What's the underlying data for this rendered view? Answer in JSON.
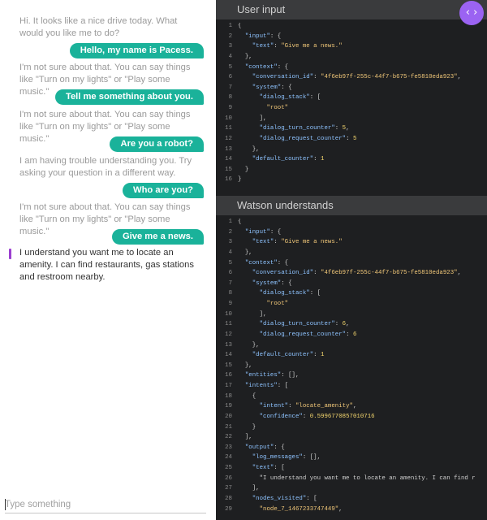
{
  "chat": {
    "messages": [
      {
        "from": "bot",
        "text": "Hi. It looks like a nice drive today. What would you like me to do?"
      },
      {
        "from": "user",
        "text": "Hello, my name is Pacess."
      },
      {
        "from": "bot",
        "text": "I'm not sure about that. You can say things like \"Turn on my lights\" or \"Play some music.\""
      },
      {
        "from": "user",
        "text": "Tell me something about you."
      },
      {
        "from": "bot",
        "text": "I'm not sure about that. You can say things like \"Turn on my lights\" or \"Play some music.\""
      },
      {
        "from": "user",
        "text": "Are you a robot?"
      },
      {
        "from": "bot",
        "text": "I am having trouble understanding you. Try asking your question in a different way."
      },
      {
        "from": "user",
        "text": "Who are you?"
      },
      {
        "from": "bot",
        "text": "I'm not sure about that. You can say things like \"Turn on my lights\" or \"Play some music.\""
      },
      {
        "from": "user",
        "text": "Give me a news."
      },
      {
        "from": "bot",
        "text": "I understand you want me to locate an amenity. I can find restaurants, gas stations and restroom nearby.",
        "latest": true
      }
    ],
    "input_placeholder": "Type something"
  },
  "panels": {
    "user_input": {
      "title": "User input",
      "lines": [
        "{",
        "  \"input\": {",
        "    \"text\": \"Give me a news.\"",
        "  },",
        "  \"context\": {",
        "    \"conversation_id\": \"4f6eb97f-255c-44f7-b675-fe5810eda923\",",
        "    \"system\": {",
        "      \"dialog_stack\": [",
        "        \"root\"",
        "      ],",
        "      \"dialog_turn_counter\": 5,",
        "      \"dialog_request_counter\": 5",
        "    },",
        "    \"default_counter\": 1",
        "  }",
        "}"
      ]
    },
    "watson": {
      "title": "Watson understands",
      "lines": [
        "{",
        "  \"input\": {",
        "    \"text\": \"Give me a news.\"",
        "  },",
        "  \"context\": {",
        "    \"conversation_id\": \"4f6eb97f-255c-44f7-b675-fe5810eda923\",",
        "    \"system\": {",
        "      \"dialog_stack\": [",
        "        \"root\"",
        "      ],",
        "      \"dialog_turn_counter\": 6,",
        "      \"dialog_request_counter\": 6",
        "    },",
        "    \"default_counter\": 1",
        "  },",
        "  \"entities\": [],",
        "  \"intents\": [",
        "    {",
        "      \"intent\": \"locate_amenity\",",
        "      \"confidence\": 0.5996770857010716",
        "    }",
        "  ],",
        "  \"output\": {",
        "    \"log_messages\": [],",
        "    \"text\": [",
        "      \"I understand you want me to locate an amenity. I can find r",
        "    ],",
        "    \"nodes_visited\": [",
        "      \"node_7_1467233747449\","
      ]
    }
  },
  "toggle": {
    "icon": "code-toggle-icon",
    "glyph": "‹ ›",
    "color": "#9b63f2"
  },
  "colors": {
    "bubble": "#1ab29a",
    "accent": "#9b3fd0",
    "code_bg": "#1e1f21",
    "panel_header": "#3a3b3d"
  }
}
